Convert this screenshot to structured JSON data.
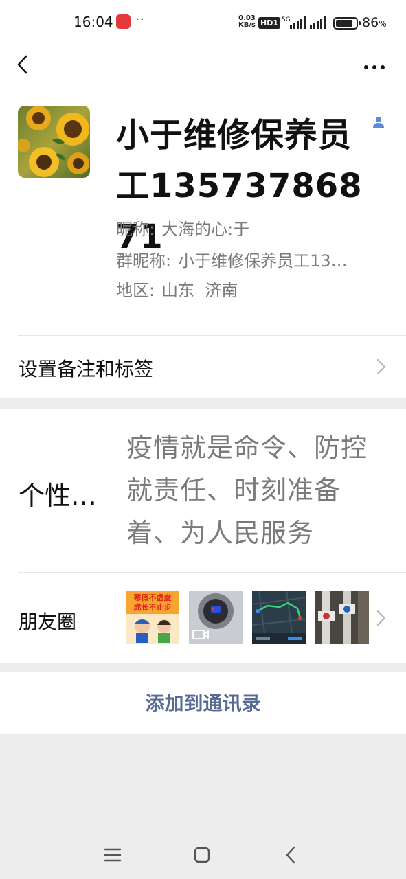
{
  "status_bar": {
    "time": "16:04",
    "dots": "··",
    "net_speed_value": "0.03",
    "net_speed_unit": "KB/s",
    "hd_badge": "HD1",
    "network_type": "5G",
    "battery_percent_text": "86",
    "battery_level": 0.86,
    "app_icon_color": "#e4393c"
  },
  "header": {
    "back_icon": "chevron-left-icon",
    "more_icon": "more-horizontal-icon"
  },
  "profile": {
    "display_name": "小于维修保养员工13573786871",
    "avatar_icon": "sunflower-avatar",
    "gender_icon": "male-person-icon",
    "gender_color": "#5b8ad6",
    "nickname_label": "昵称:",
    "nickname": "大海的心:于",
    "group_nickname_label": "群昵称:",
    "group_nickname": "小于维修保养员工13…",
    "region_label": "地区:",
    "region": "山东  济南"
  },
  "remark_row": {
    "label": "设置备注和标签"
  },
  "signature": {
    "label": "个性…",
    "text": "疫情就是命令、防控就责任、时刻准备着、为人民服务"
  },
  "moments": {
    "label": "朋友圈",
    "thumbnails": [
      {
        "kind": "poster",
        "text_line1": "寒假不虚度",
        "text_line2": "成长不止步"
      },
      {
        "kind": "video",
        "icon": "video-camera-icon"
      },
      {
        "kind": "map"
      },
      {
        "kind": "pipes"
      }
    ]
  },
  "actions": {
    "add_to_contacts": "添加到通讯录",
    "link_color": "#576b95"
  },
  "navbar": {
    "menu_icon": "menu-icon",
    "home_icon": "home-square-icon",
    "back_icon": "back-triangle-icon"
  }
}
